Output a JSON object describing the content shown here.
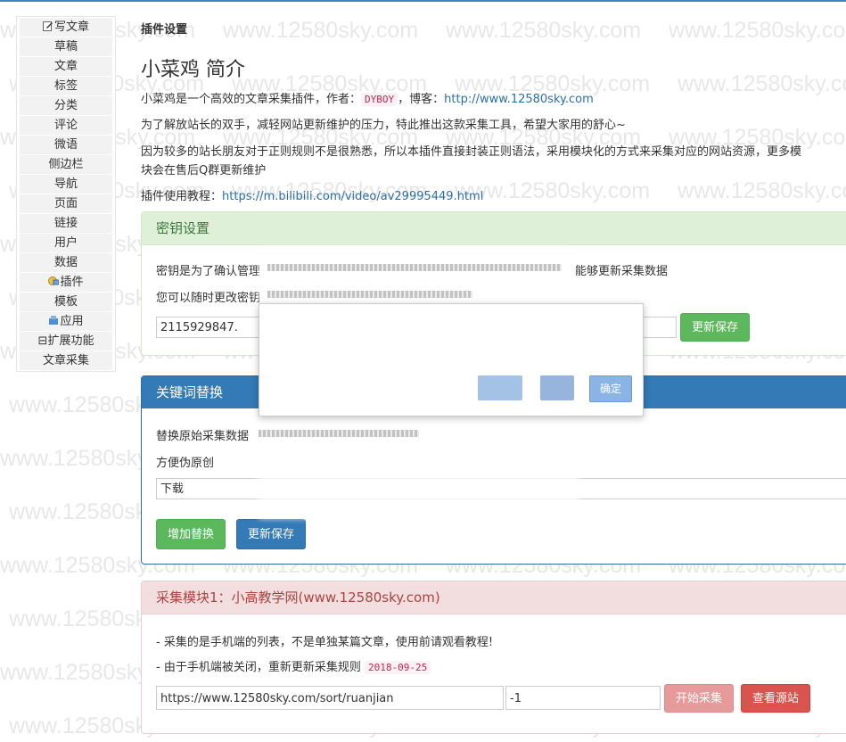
{
  "sidebar": {
    "items": [
      {
        "label": "写文章",
        "icon": "edit-icon"
      },
      {
        "label": "草稿"
      },
      {
        "label": "文章"
      },
      {
        "label": "标签"
      },
      {
        "label": "分类"
      },
      {
        "label": "评论"
      },
      {
        "label": "微语"
      },
      {
        "label": "侧边栏"
      },
      {
        "label": "导航"
      },
      {
        "label": "页面"
      },
      {
        "label": "链接"
      },
      {
        "label": "用户"
      },
      {
        "label": "数据"
      },
      {
        "label": "插件",
        "icon": "plugin-icon"
      },
      {
        "label": "模板"
      },
      {
        "label": "应用",
        "icon": "app-icon"
      },
      {
        "label": "⊟扩展功能"
      },
      {
        "label": "文章采集"
      }
    ]
  },
  "page": {
    "breadcrumb": "插件设置",
    "title": "小菜鸡 简介",
    "intro_prefix": "小菜鸡是一个高效的文章采集插件，作者：",
    "author": "DYBOY",
    "intro_mid": "，博客：",
    "blog_url": "http://www.12580sky.com",
    "line2": "为了解放站长的双手，减轻网站更新维护的压力，特此推出这款采集工具，希望大家用的舒心~",
    "line3a": "因为较多的站长朋友对于正则规则不是很熟悉，所以本插件直接封装正则语法，采用模块化的方式来采集对应的网站资源，更多模",
    "line3b": "块会在售后Q群更新维护",
    "tutorial_label": "插件使用教程：",
    "tutorial_url": "https://m.bilibili.com/video/av29995449.html"
  },
  "key_panel": {
    "title": "密钥设置",
    "desc1_start": "密钥是为了确认管理",
    "desc1_end": "能够更新采集数据",
    "desc2_start": "您可以随时更改密钥",
    "key_value": "2115929847.",
    "save_button": "更新保存"
  },
  "keyword_panel": {
    "title": "关键词替换",
    "desc1_start": "替换原始采集数据",
    "desc2": "方便伪原创",
    "input_value": "下载",
    "add_button": "增加替换",
    "save_button": "更新保存"
  },
  "module_panel": {
    "title": "采集模块1：小高教学网(www.12580sky.com)",
    "note1": "- 采集的是手机端的列表，不是单独某篇文章，使用前请观看教程!",
    "note2_prefix": "- 由于手机端被关闭，重新更新采集规则",
    "note2_date": "2018-09-25",
    "url_value": "https://www.12580sky.com/sort/ruanjian",
    "page_value": "-1",
    "start_button": "开始采集",
    "view_button": "查看源站"
  },
  "dialog": {
    "ok_button": "确定"
  },
  "watermark": "www.12580sky.com"
}
